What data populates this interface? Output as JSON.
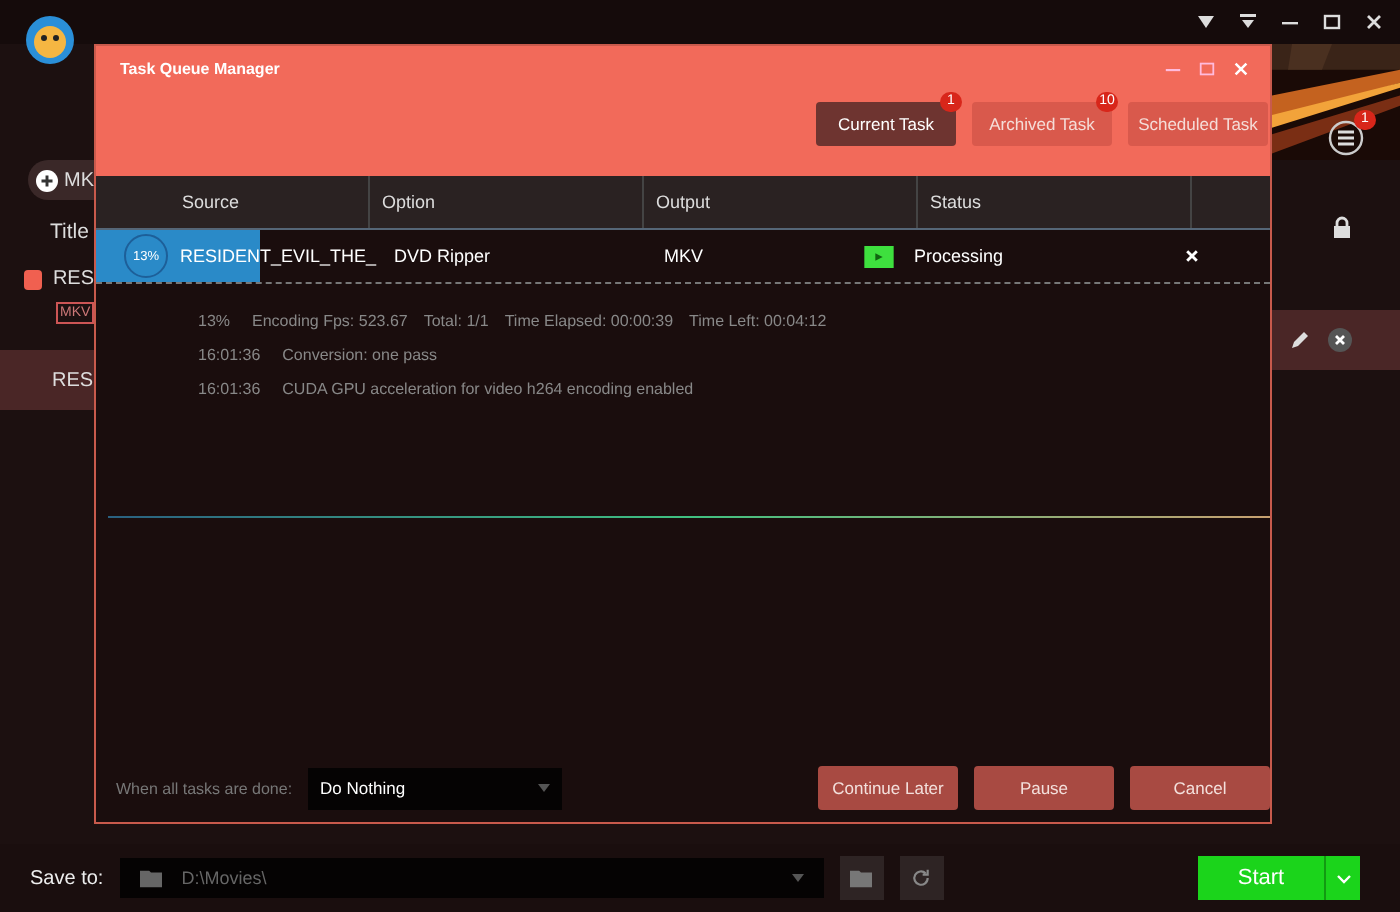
{
  "background_app": {
    "add_button": "MK",
    "title_label": "Title",
    "title_item": {
      "name": "RES",
      "checked": true
    },
    "format_tag": "MKV",
    "queued_item": "RES",
    "menu_badge": "1"
  },
  "dialog": {
    "title": "Task Queue Manager",
    "tabs": [
      {
        "label": "Current Task",
        "badge": "1",
        "selected": true
      },
      {
        "label": "Archived Task",
        "badge": "10",
        "selected": false
      },
      {
        "label": "Scheduled Task",
        "selected": false
      }
    ],
    "columns": [
      "Source",
      "Option",
      "Output",
      "Status"
    ],
    "task": {
      "progress": "13%",
      "level": 0.13,
      "source": "RESIDENT_EVIL_THE_",
      "option": "DVD Ripper",
      "output": "MKV",
      "status": "Processing"
    },
    "stats": [
      "13%",
      "Encoding Fps: 523.67",
      "Total: 1/1",
      "Time Elapsed: 00:00:39",
      "Time Left: 00:04:12"
    ],
    "log": [
      {
        "time": "16:01:36",
        "message": "Conversion: one pass"
      },
      {
        "time": "16:01:36",
        "message": "CUDA GPU acceleration for video h264 encoding enabled"
      }
    ],
    "when_done_label": "When all tasks are done:",
    "when_done_value": "Do Nothing",
    "buttons": [
      "Continue Later",
      "Pause",
      "Cancel"
    ]
  },
  "bottom_bar": {
    "save_label": "Save to:",
    "path": "D:\\Movies\\",
    "start": "Start"
  }
}
